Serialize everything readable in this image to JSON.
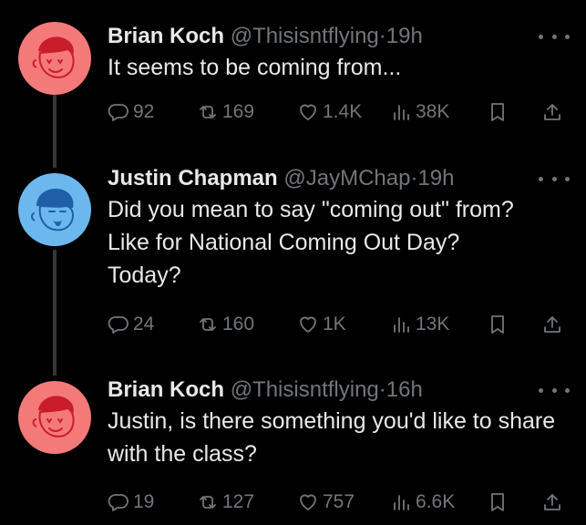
{
  "thread": [
    {
      "name": "Brian Koch",
      "handle": "@Thisisntflying",
      "separator": "·",
      "time": "19h",
      "text": "It seems to be coming from...",
      "replies": "92",
      "reposts": "169",
      "likes": "1.4K",
      "views": "38K",
      "avatar_color": "#f47a7a",
      "icons": [
        "reply-icon",
        "repost-icon",
        "like-icon",
        "views-icon",
        "bookmark-icon",
        "share-icon"
      ]
    },
    {
      "name": "Justin Chapman",
      "handle": "@JayMChap",
      "separator": "·",
      "time": "19h",
      "text": "Did you mean to say \"coming out\" from? Like for National Coming Out Day? Today?",
      "replies": "24",
      "reposts": "160",
      "likes": "1K",
      "views": "13K",
      "avatar_color": "#6cb8ee",
      "icons": [
        "reply-icon",
        "repost-icon",
        "like-icon",
        "views-icon",
        "bookmark-icon",
        "share-icon"
      ]
    },
    {
      "name": "Brian Koch",
      "handle": "@Thisisntflying",
      "separator": "·",
      "time": "16h",
      "text": "Justin, is there something you'd like to share with the class?",
      "replies": "19",
      "reposts": "127",
      "likes": "757",
      "views": "6.6K",
      "avatar_color": "#f47a7a",
      "icons": [
        "reply-icon",
        "repost-icon",
        "like-icon",
        "views-icon",
        "bookmark-icon",
        "share-icon"
      ]
    }
  ],
  "colors": {
    "background": "#000000",
    "primary_text": "#e7e9ea",
    "secondary_text": "#71767b",
    "thread_line": "#333639"
  }
}
